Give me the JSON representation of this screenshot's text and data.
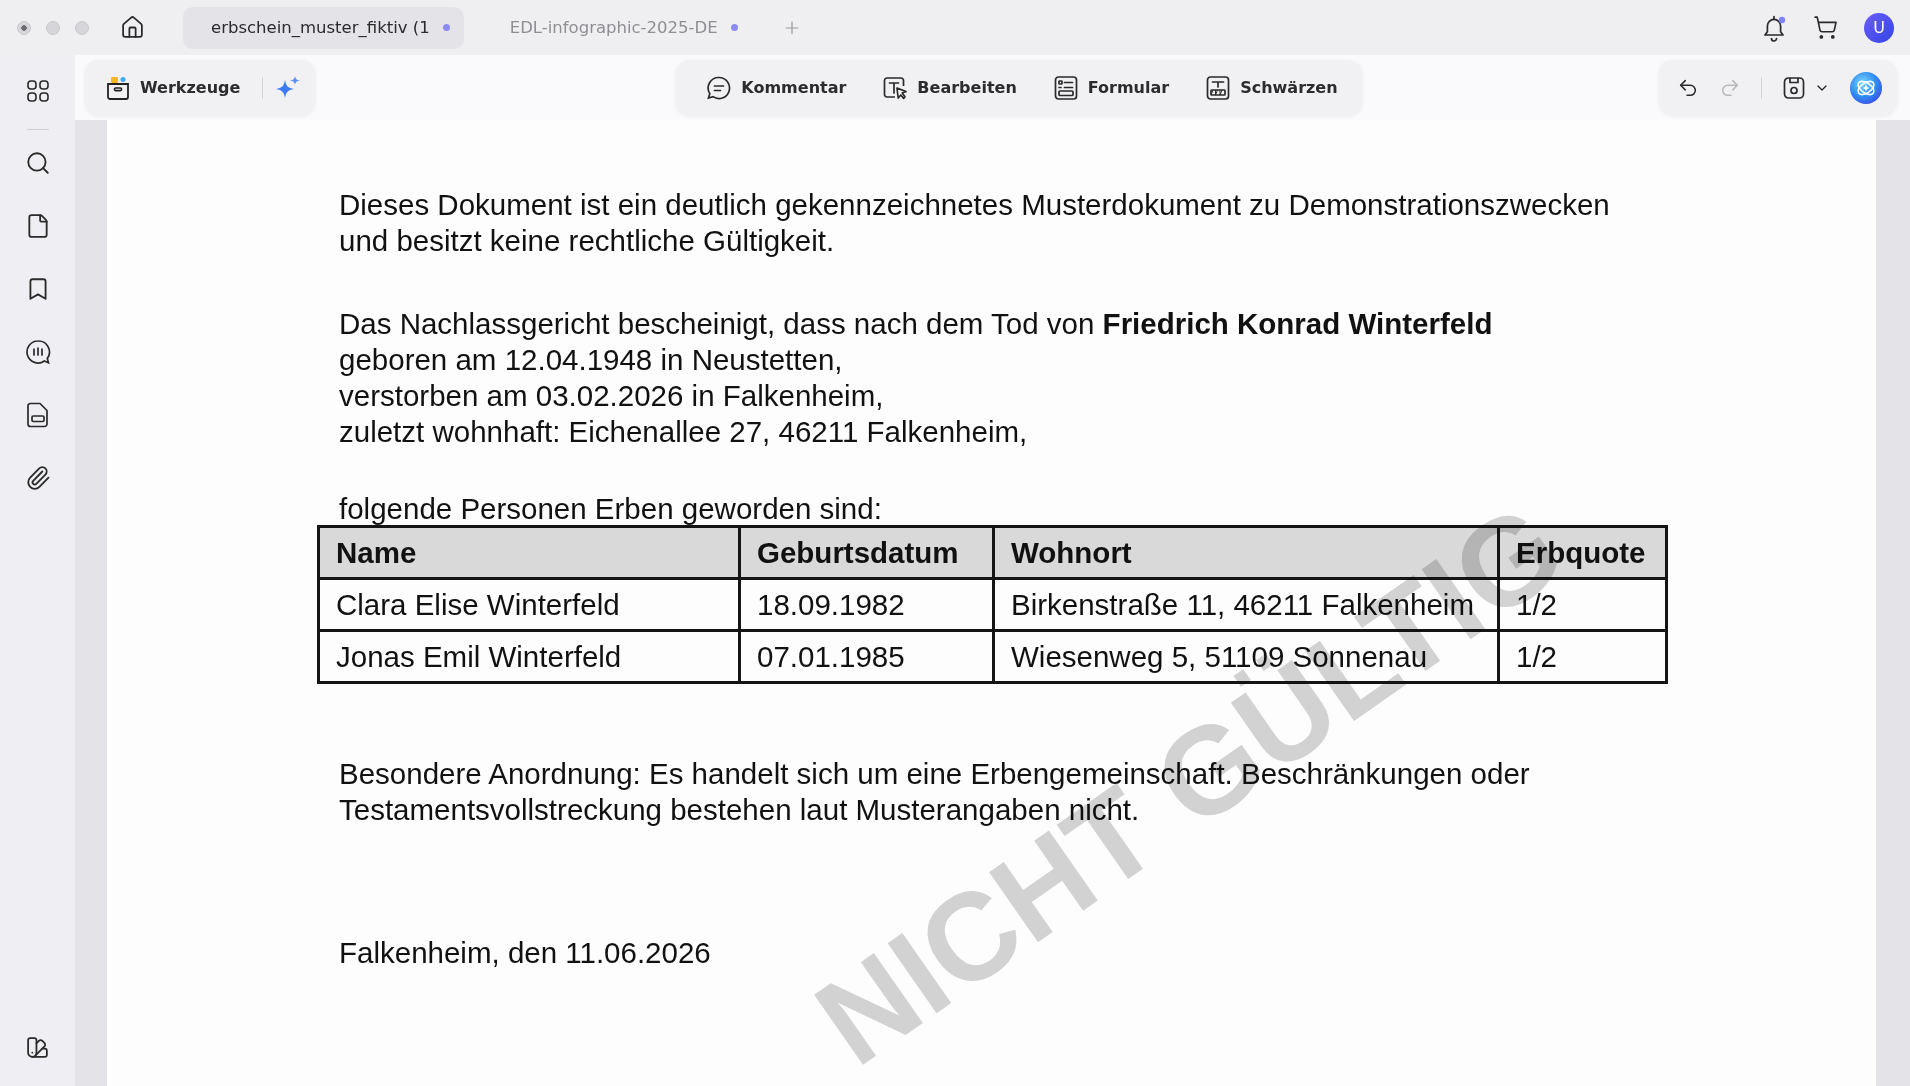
{
  "window": {
    "tabs": [
      {
        "title": "erbschein_muster_fiktiv (1",
        "selected": true,
        "unsaved": true
      },
      {
        "title": "EDL-infographic-2025-DE",
        "selected": false,
        "unsaved": true
      }
    ]
  },
  "header": {
    "bell_unread": true,
    "avatar": "U"
  },
  "toolbar": {
    "tools_label": "Werkzeuge",
    "modes": [
      {
        "label": "Kommentar",
        "selected": false
      },
      {
        "label": "Bearbeiten",
        "selected": false
      },
      {
        "label": "Formular",
        "selected": false
      },
      {
        "label": "Schwärzen",
        "selected": false
      }
    ],
    "undo_disabled": false,
    "redo_disabled": true
  },
  "document": {
    "notice": [
      "Dieses Dokument ist ein deutlich gekennzeichnetes Musterdokument zu Demonstrationszwecken",
      "und besitzt keine rechtliche Gültigkeit."
    ],
    "certification": [
      "Das Nachlassgericht bescheinigt, dass nach dem Tod von **Friedrich Konrad Winterfeld**",
      "geboren am 12.04.1948 in Neustetten,",
      "verstorben am 03.02.2026 in Falkenheim,",
      "zuletzt wohnhaft: Eichenallee 27, 46211 Falkenheim,"
    ],
    "heirs_intro": "folgende Personen Erben geworden sind:",
    "heirs_table": {
      "columns": [
        "Name",
        "Geburtsdatum",
        "Wohnort",
        "Erbquote"
      ],
      "rows": [
        [
          "Clara Elise Winterfeld",
          "18.09.1982",
          "Birkenstraße 11, 46211 Falkenheim",
          "1/2"
        ],
        [
          "Jonas Emil Winterfeld",
          "07.01.1985",
          "Wiesenweg 5, 51109 Sonnenau",
          "1/2"
        ]
      ]
    },
    "special_order": [
      "Besondere Anordnung: Es handelt sich um eine Erbengemeinschaft. Beschränkungen oder",
      "Testamentsvollstreckung bestehen laut Musterangaben nicht."
    ],
    "place_date": "Falkenheim, den 11.06.2026",
    "watermark": "NICHT GÜLTIG"
  }
}
